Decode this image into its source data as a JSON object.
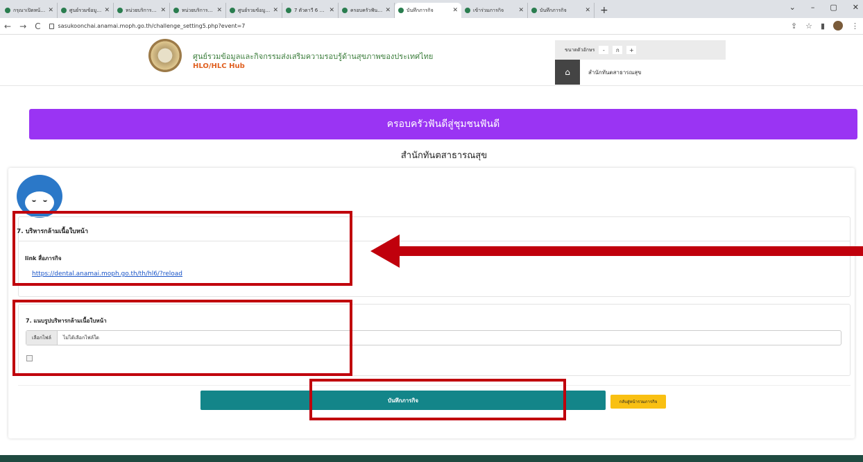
{
  "browser": {
    "tabs": [
      {
        "title": "กรุณาเปิดหน้าจอนี้ใ..."
      },
      {
        "title": "ศูนย์รวมข้อมูลและกิ..."
      },
      {
        "title": "หน่วยบริการต้นแบบ..."
      },
      {
        "title": "หน่วยบริการต้นแบบ..."
      },
      {
        "title": "ศูนย์รวมข้อมูลและกิ..."
      },
      {
        "title": "7 ตัวดาวี 6 ภารกิจ..."
      },
      {
        "title": "ครอบครัวฟันดีสู่ชุมช..."
      },
      {
        "title": "บันทึกภารกิจ"
      },
      {
        "title": "เข้าร่วมภารกิจ"
      },
      {
        "title": "บันทึกภารกิจ"
      }
    ],
    "active_tab": 7,
    "url": "sasukoonchai.anamai.moph.go.th/challenge_setting5.php?event=7"
  },
  "header": {
    "site_title": "ศูนย์รวมข้อมูลและกิจกรรมส่งเสริมความรอบรู้ด้านสุขภาพของประเทศไทย",
    "site_subtitle": "HLO/HLC Hub",
    "font_size_label": "ขนาดตัวอักษร",
    "font_decrease": "-",
    "font_normal": "ก",
    "font_increase": "+",
    "org_name": "สำนักทันตสาธารณสุข"
  },
  "banner": {
    "title": "ครอบครัวฟันดีสู่ชุมชนฟันดี"
  },
  "page": {
    "subtitle": "สำนักทันตสาธารณสุข"
  },
  "mission": {
    "title": "7. บริหารกล้ามเนื้อใบหน้า",
    "link_label": "link สื่อภารกิจ",
    "link_url": "https://dental.anamai.moph.go.th/th/hl6/?reload"
  },
  "upload": {
    "title": "7. แนบรูปบริหารกล้ามเนื้อใบหน้า",
    "choose_file": "เลือกไฟล์",
    "no_file": "ไม่ได้เลือกไฟล์ใด"
  },
  "actions": {
    "save": "บันทึกภารกิจ",
    "back": "กลับสู่หน้ารวมภารกิจ"
  },
  "colors": {
    "banner": "#9a34f3",
    "save_button": "#138589",
    "back_button": "#f9c012",
    "highlight": "#c0000c"
  }
}
